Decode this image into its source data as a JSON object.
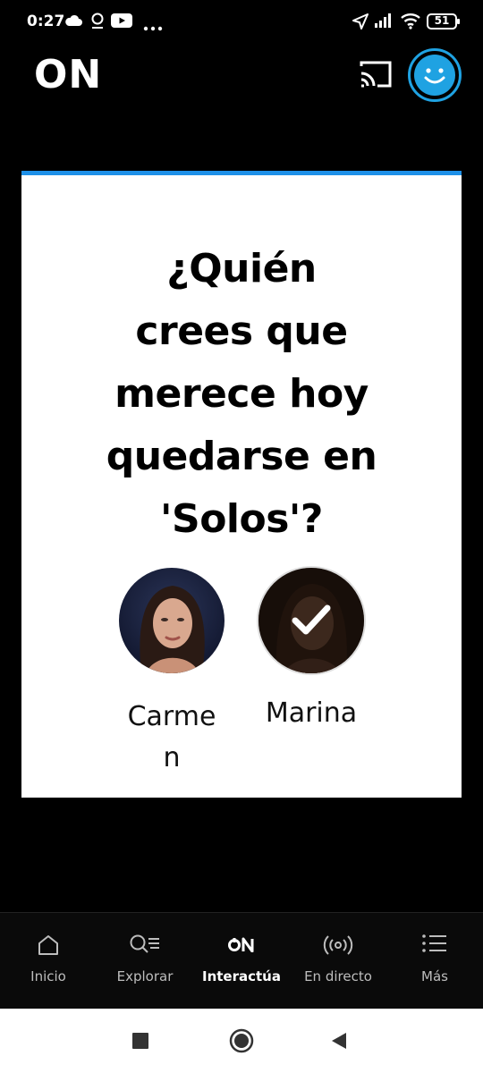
{
  "status_bar": {
    "time": "0:27",
    "icons_left": [
      "cloud-icon",
      "location-pin-icon",
      "youtube-icon",
      "more-dots-icon"
    ],
    "icons_right": [
      "navigation-icon",
      "signal-icon",
      "wifi-icon",
      "battery-icon"
    ],
    "battery": "51"
  },
  "header": {
    "logo": "ON",
    "cast_icon": "cast-icon",
    "profile_icon": "smiley-avatar-icon",
    "accent": "#1fa2e2"
  },
  "card": {
    "accent": "#1e90e8",
    "question_lines": [
      "¿Quién",
      "crees que",
      "merece hoy",
      "quedarse en",
      "'Solos'?"
    ],
    "options": [
      {
        "name_line1": "Carme",
        "name_line2": "n",
        "selected": false
      },
      {
        "name": "Marina",
        "selected": true
      }
    ]
  },
  "bottom_nav": {
    "items": [
      {
        "label": "Inicio",
        "icon": "home-icon"
      },
      {
        "label": "Explorar",
        "icon": "search-list-icon"
      },
      {
        "label": "Interactúa",
        "icon": "on-logo-icon",
        "active": true
      },
      {
        "label": "En directo",
        "icon": "broadcast-icon"
      },
      {
        "label": "Más",
        "icon": "menu-list-icon"
      }
    ]
  },
  "system_nav": [
    "recents-square-icon",
    "home-circle-icon",
    "back-triangle-icon"
  ]
}
